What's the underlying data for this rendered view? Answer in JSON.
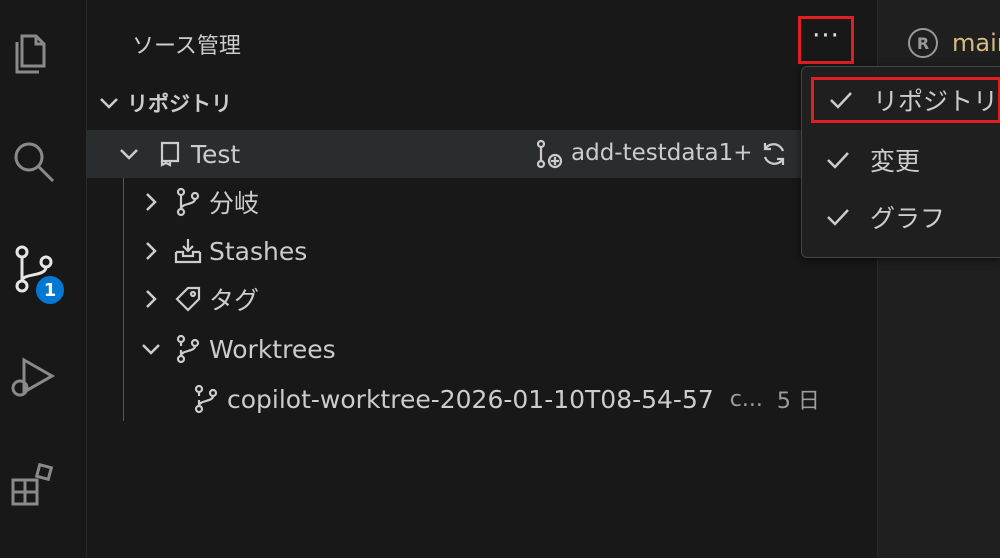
{
  "activity_bar": {
    "icons": [
      "files-icon",
      "search-icon",
      "source-control-icon",
      "run-debug-icon",
      "extensions-icon"
    ],
    "scm_badge": "1"
  },
  "sidebar": {
    "title": "ソース管理",
    "more_button_label": "···",
    "section_header": "リポジトリ",
    "repo": {
      "name": "Test",
      "branch": "add-testdata1+"
    },
    "tree": {
      "branches": "分岐",
      "stashes": "Stashes",
      "tags": "タグ",
      "worktrees": "Worktrees",
      "worktree_item": "copilot-worktree-2026-01-10T08-54-57",
      "worktree_desc": "c...",
      "worktree_age": "5 日"
    }
  },
  "menu": {
    "items": [
      {
        "label": "リポジトリ",
        "checked": true
      },
      {
        "label": "変更",
        "checked": true
      },
      {
        "label": "グラフ",
        "checked": true
      }
    ]
  },
  "editor": {
    "tab_label": "main"
  },
  "colors": {
    "accent": "#0078d4",
    "highlight_box": "#e02020",
    "tab_text": "#d7ba7d"
  }
}
